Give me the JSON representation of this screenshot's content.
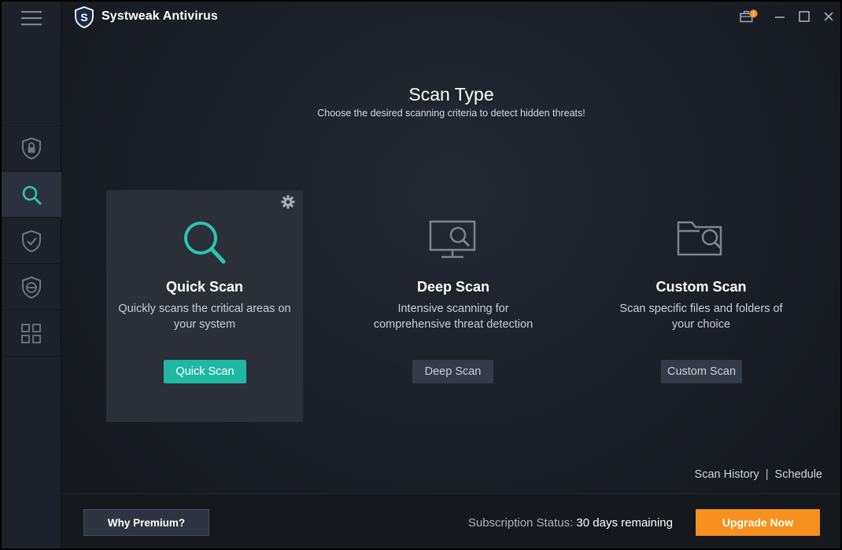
{
  "app": {
    "title": "Systweak Antivirus"
  },
  "sidebar": {
    "items": [
      {
        "name": "protection",
        "icon": "shield-lock-icon",
        "active": false
      },
      {
        "name": "scan",
        "icon": "search-icon",
        "active": true
      },
      {
        "name": "real-time-protection",
        "icon": "shield-check-icon",
        "active": false
      },
      {
        "name": "web-security",
        "icon": "shield-e-icon",
        "active": false
      },
      {
        "name": "apps",
        "icon": "grid-icon",
        "active": false
      }
    ]
  },
  "header": {
    "title": "Scan Type",
    "subtitle": "Choose the desired scanning criteria to detect hidden threats!"
  },
  "cards": [
    {
      "name": "Quick Scan",
      "description": "Quickly scans the critical areas on your system",
      "button": "Quick Scan",
      "icon": "magnifier-icon",
      "selected": true
    },
    {
      "name": "Deep Scan",
      "description": "Intensive scanning for comprehensive threat detection",
      "button": "Deep Scan",
      "icon": "monitor-search-icon",
      "selected": false
    },
    {
      "name": "Custom Scan",
      "description": "Scan specific files and folders of your choice",
      "button": "Custom Scan",
      "icon": "folder-search-icon",
      "selected": false
    }
  ],
  "links": {
    "history": "Scan History",
    "separator": "|",
    "schedule": "Schedule"
  },
  "footer": {
    "why_premium": "Why Premium?",
    "subscription_label": "Subscription Status:",
    "subscription_value": "30 days remaining",
    "upgrade": "Upgrade Now",
    "notification_badge": "!"
  },
  "colors": {
    "accent": "#1fb8a1",
    "upgrade": "#f7901e",
    "background": "#161920",
    "sidebar": "#1d2129"
  }
}
